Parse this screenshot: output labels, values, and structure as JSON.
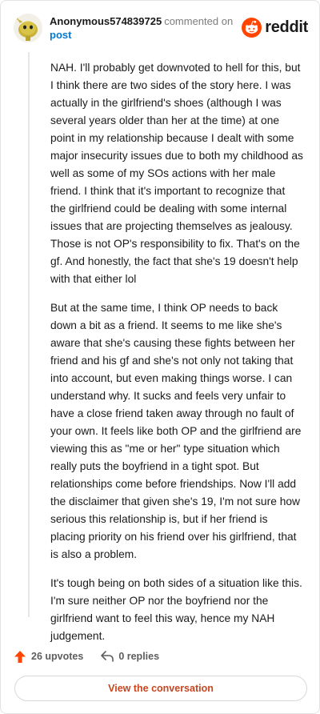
{
  "header": {
    "username": "Anonymous574839725",
    "action_text": "commented on",
    "post_link": "post",
    "brand_name": "reddit"
  },
  "comment": {
    "paragraphs": [
      "NAH. I'll probably get downvoted to hell for this, but I think there are two sides of the story here. I was actually in the girlfriend's shoes (although I was several years older than her at the time) at one point in my relationship because I dealt with some major insecurity issues due to both my childhood as well as some of my SOs actions with her male friend. I think that it's important to recognize that the girlfriend could be dealing with some internal issues that are projecting themselves as jealousy. Those is not OP's responsibility to fix. That's on the gf. And honestly, the fact that she's 19 doesn't help with that either lol",
      "But at the same time, I think OP needs to back down a bit as a friend. It seems to me like she's aware that she's causing these fights between her friend and his gf and she's not only not taking that into account, but even making things worse. I can understand why. It sucks and feels very unfair to have a close friend taken away through no fault of your own. It feels like both OP and the girlfriend are viewing this as \"me or her\" type situation which really puts the boyfriend in a tight spot. But relationships come before friendships. Now I'll add the disclaimer that given she's 19, I'm not sure how serious this relationship is, but if her friend is placing priority on his friend over his girlfriend, that is also a problem.",
      "It's tough being on both sides of a situation like this. I'm sure neither OP nor the boyfriend nor the girlfriend want to feel this way, hence my NAH judgement."
    ]
  },
  "footer": {
    "upvotes": "26 upvotes",
    "replies": "0 replies",
    "view_button": "View the conversation"
  },
  "colors": {
    "upvote": "#ff4500",
    "link": "#0079d3",
    "button_text": "#c74620"
  },
  "icons": [
    "avatar-icon",
    "reddit-logo-icon",
    "upvote-icon",
    "reply-icon"
  ]
}
